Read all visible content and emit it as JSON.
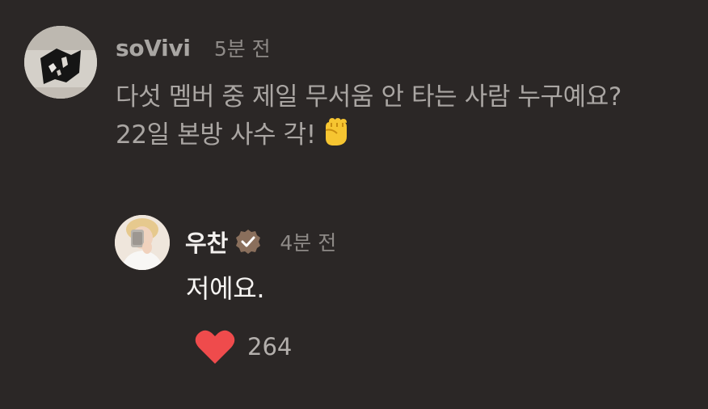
{
  "comment": {
    "username": "soVivi",
    "time": "5분 전",
    "text_line1": "다섯 멤버 중 제일 무서움 안 타는 사람 누구예요?",
    "text_line2": "22일 본방 사수 각!",
    "emoji": "✊"
  },
  "reply": {
    "username": "우찬",
    "verified": true,
    "time": "4분 전",
    "text": "저에요.",
    "likes": "264",
    "like_icon_color": "#ef4b4c",
    "badge_color": "#8a6f5c"
  }
}
